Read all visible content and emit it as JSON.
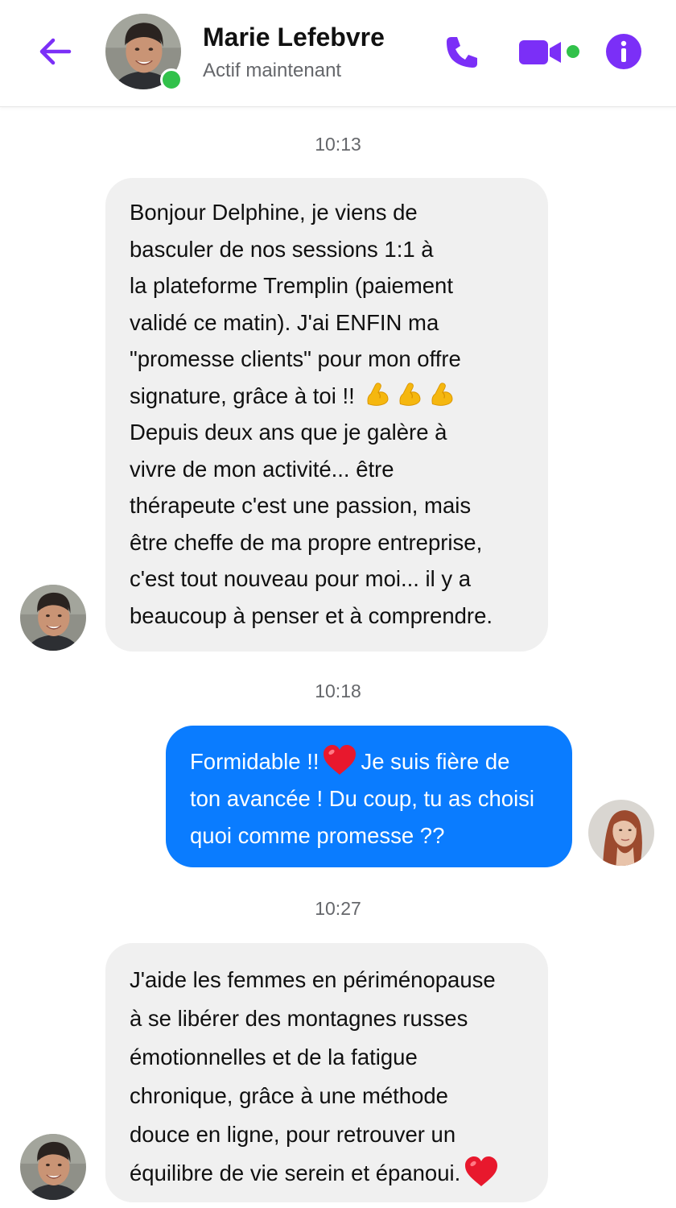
{
  "contact": {
    "name": "Marie Lefebvre",
    "status": "Actif maintenant"
  },
  "colors": {
    "accent": "#7b2ff7",
    "online": "#31c14a",
    "outgoing_bubble": "#0a7cff",
    "incoming_bubble": "#f0f0f0"
  },
  "header_icons": [
    "back-arrow-icon",
    "phone-icon",
    "video-camera-icon",
    "info-icon"
  ],
  "messages": [
    {
      "time": "10:13",
      "direction": "incoming",
      "text_a": "Bonjour Delphine, je viens de\nbasculer de nos sessions 1:1 à\nla plateforme Tremplin (paiement\nvalidé ce matin). J'ai ENFIN ma\n\"promesse clients\" pour mon offre\nsignature, grâce à toi !!",
      "emoji_a": "💪💪💪",
      "text_b": "\nDepuis deux ans que je galère à\nvivre de mon activité... être\nthérapeute c'est une passion, mais\nêtre cheffe de ma propre entreprise,\nc'est tout nouveau pour moi... il y a\nbeaucoup à penser et à comprendre."
    },
    {
      "time": "10:18",
      "direction": "outgoing",
      "text_a": "Formidable !!",
      "emoji_a": "❤️",
      "text_b": "Je suis fière de\nton avancée ! Du coup, tu as choisi\nquoi comme promesse ??"
    },
    {
      "time": "10:27",
      "direction": "incoming",
      "text_a": "J'aide les femmes en périménopause\nà se libérer des montagnes russes\némotionnelles et de la fatigue\nchronique, grâce à une méthode\ndouce en ligne, pour retrouver un\néquilibre de vie serein et épanoui.",
      "emoji_a": "❤️"
    }
  ]
}
